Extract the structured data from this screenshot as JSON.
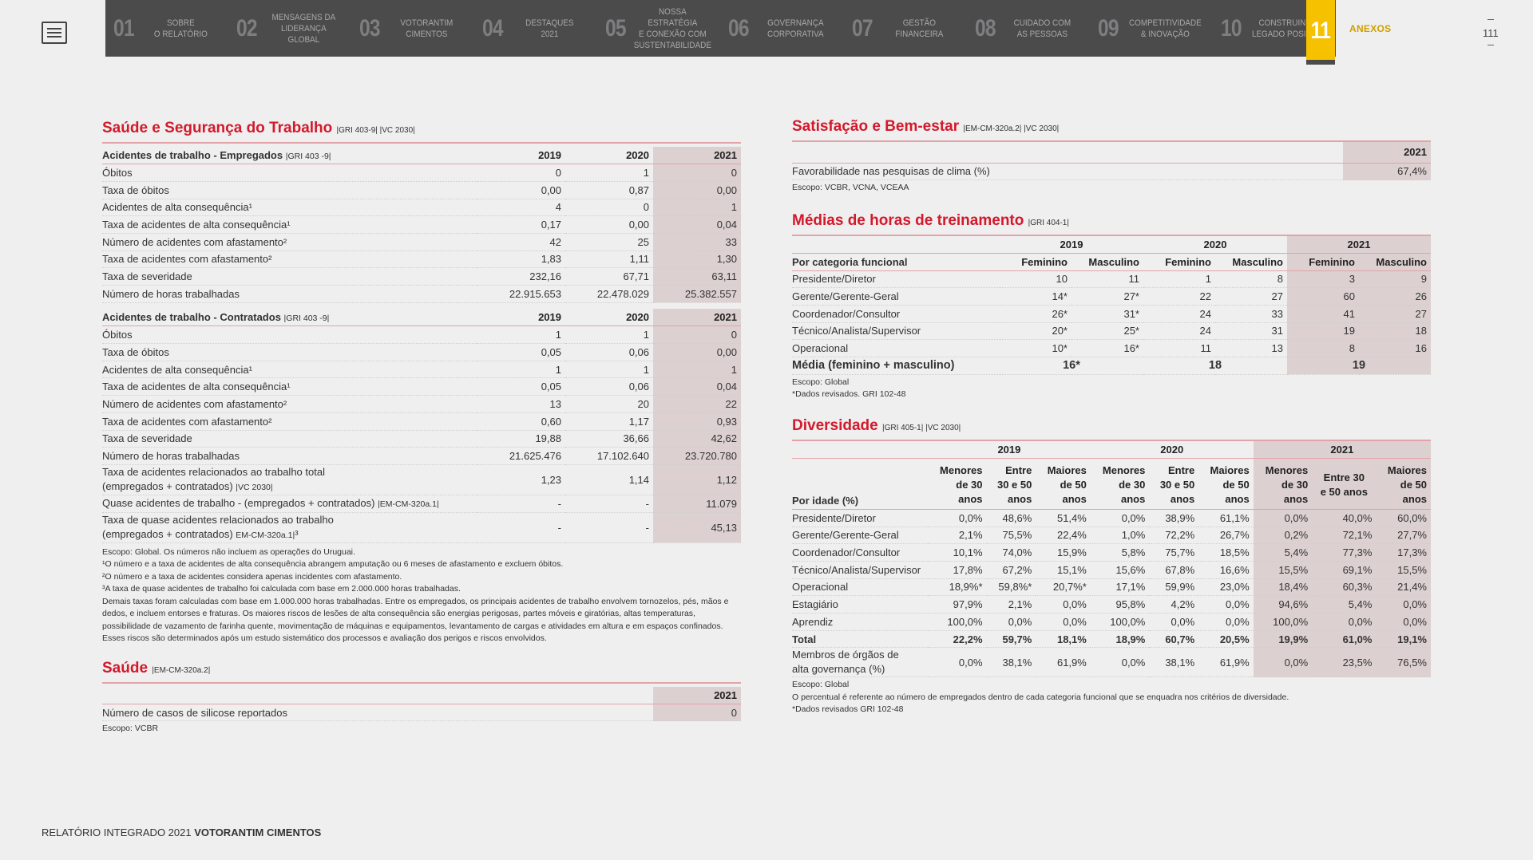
{
  "nav": {
    "items": [
      {
        "num": "01",
        "label": "SOBRE<br>O RELATÓRIO"
      },
      {
        "num": "02",
        "label": "MENSAGENS DA<br>LIDERANÇA GLOBAL"
      },
      {
        "num": "03",
        "label": "VOTORANTIM<br>CIMENTOS"
      },
      {
        "num": "04",
        "label": "DESTAQUES<br>2021"
      },
      {
        "num": "05",
        "label": "NOSSA ESTRATÉGIA<br>E CONEXÃO COM<br>SUSTENTABILIDADE"
      },
      {
        "num": "06",
        "label": "GOVERNANÇA<br>CORPORATIVA"
      },
      {
        "num": "07",
        "label": "GESTÃO<br>FINANCEIRA"
      },
      {
        "num": "08",
        "label": "CUIDADO COM<br>AS PESSOAS"
      },
      {
        "num": "09",
        "label": "COMPETITIVIDADE<br>& INOVAÇÃO"
      },
      {
        "num": "10",
        "label": "CONSTRUINDO<br>LEGADO POSITIVO"
      }
    ],
    "active_num": "11",
    "anexos": "ANEXOS",
    "page_number": "111"
  },
  "saude_seg": {
    "title": "Saúde e Segurança do Trabalho",
    "tag": "|GRI 403-9| |VC 2030|",
    "years": [
      "2019",
      "2020",
      "2021"
    ],
    "empregados": {
      "title": "Acidentes de trabalho - Empregados",
      "tag": "|GRI 403 -9|",
      "rows": [
        {
          "label": "Óbitos",
          "v": [
            "0",
            "1",
            "0"
          ]
        },
        {
          "label": "Taxa de óbitos",
          "v": [
            "0,00",
            "0,87",
            "0,00"
          ]
        },
        {
          "label": "Acidentes de alta consequência¹",
          "v": [
            "4",
            "0",
            "1"
          ]
        },
        {
          "label": "Taxa de acidentes de alta consequência¹",
          "v": [
            "0,17",
            "0,00",
            "0,04"
          ]
        },
        {
          "label": "Número de acidentes com afastamento²",
          "v": [
            "42",
            "25",
            "33"
          ]
        },
        {
          "label": "Taxa de acidentes com afastamento²",
          "v": [
            "1,83",
            "1,11",
            "1,30"
          ]
        },
        {
          "label": "Taxa de severidade",
          "v": [
            "232,16",
            "67,71",
            "63,11"
          ]
        },
        {
          "label": "Número de horas trabalhadas",
          "v": [
            "22.915.653",
            "22.478.029",
            "25.382.557"
          ]
        }
      ]
    },
    "contratados": {
      "title": "Acidentes de trabalho - Contratados",
      "tag": "|GRI 403 -9|",
      "rows": [
        {
          "label": "Óbitos",
          "v": [
            "1",
            "1",
            "0"
          ]
        },
        {
          "label": "Taxa de óbitos",
          "v": [
            "0,05",
            "0,06",
            "0,00"
          ]
        },
        {
          "label": "Acidentes de alta consequência¹",
          "v": [
            "1",
            "1",
            "1"
          ]
        },
        {
          "label": "Taxa de acidentes de alta consequência¹",
          "v": [
            "0,05",
            "0,06",
            "0,04"
          ]
        },
        {
          "label": "Número de acidentes com afastamento²",
          "v": [
            "13",
            "20",
            "22"
          ]
        },
        {
          "label": "Taxa de acidentes com afastamento²",
          "v": [
            "0,60",
            "1,17",
            "0,93"
          ]
        },
        {
          "label": "Taxa de severidade",
          "v": [
            "19,88",
            "36,66",
            "42,62"
          ]
        },
        {
          "label": "Número de horas trabalhadas",
          "v": [
            "21.625.476",
            "17.102.640",
            "23.720.780"
          ]
        }
      ],
      "extra": [
        {
          "label": "Taxa de acidentes relacionados ao trabalho total<br>(empregados + contratados) <b class='small'>|VC 2030|</b>",
          "v": [
            "1,23",
            "1,14",
            "1,12"
          ]
        },
        {
          "label": "Quase acidentes de trabalho - (empregados + contratados) <b class='small'>|EM-CM-320a.1|</b>",
          "v": [
            "-",
            "-",
            "11.079"
          ]
        },
        {
          "label": "Taxa de quase acidentes relacionados ao trabalho<br>(empregados + contratados) <b class='small'>EM-CM-320a.1|</b>³",
          "v": [
            "-",
            "-",
            "45,13"
          ]
        }
      ]
    },
    "notes": "Escopo: Global. Os números não incluem as operações do Uruguai.<br>¹O número e a taxa de acidentes de alta consequência abrangem amputação ou 6 meses de afastamento e excluem óbitos.<br>²O número e a taxa de acidentes considera apenas incidentes com afastamento.<br>³A taxa de quase acidentes de trabalho foi calculada com base em 2.000.000 horas trabalhadas.<br>Demais taxas foram calculadas com base em 1.000.000 horas trabalhadas. Entre os empregados, os principais acidentes de trabalho envolvem tornozelos, pés, mãos e dedos, e incluem entorses e fraturas. Os maiores riscos de lesões de alta consequência são energias perigosas, partes móveis e giratórias, altas temperaturas, possibilidade de vazamento de farinha quente, movimentação de máquinas e equipamentos, levantamento de cargas e atividades em altura e em espaços confinados. Esses riscos são determinados após um estudo sistemático dos processos e avaliação dos perigos e riscos envolvidos."
  },
  "saude": {
    "title": "Saúde",
    "tag": "|EM-CM-320a.2|",
    "year": "2021",
    "row_label": "Número de casos de silicose reportados",
    "row_value": "0",
    "note": "Escopo: VCBR"
  },
  "satisfacao": {
    "title": "Satisfação e Bem-estar",
    "tag": "|EM-CM-320a.2| |VC 2030|",
    "year": "2021",
    "row_label": "Favorabilidade nas pesquisas de clima (%)",
    "row_value": "67,4%",
    "note": "Escopo: VCBR, VCNA, VCEAA"
  },
  "treinamento": {
    "title": "Médias de horas de treinamento",
    "tag": "|GRI 404-1|",
    "years": [
      "2019",
      "2020",
      "2021"
    ],
    "cat_label": "Por categoria funcional",
    "sub": [
      "Feminino",
      "Masculino"
    ],
    "rows": [
      {
        "label": "Presidente/Diretor",
        "v": [
          "10",
          "11",
          "1",
          "8",
          "3",
          "9"
        ]
      },
      {
        "label": "Gerente/Gerente-Geral",
        "v": [
          "14*",
          "27*",
          "22",
          "27",
          "60",
          "26"
        ]
      },
      {
        "label": "Coordenador/Consultor",
        "v": [
          "26*",
          "31*",
          "24",
          "33",
          "41",
          "27"
        ]
      },
      {
        "label": "Técnico/Analista/Supervisor",
        "v": [
          "20*",
          "25*",
          "24",
          "31",
          "19",
          "18"
        ]
      },
      {
        "label": "Operacional",
        "v": [
          "10*",
          "16*",
          "11",
          "13",
          "8",
          "16"
        ]
      }
    ],
    "avg_label": "Média (feminino + masculino)",
    "avg": [
      "16*",
      "18",
      "19"
    ],
    "notes": "Escopo: Global<br>*Dados revisados. GRI 102-48"
  },
  "diversidade": {
    "title": "Diversidade",
    "tag": "|GRI 405-1| |VC 2030|",
    "years": [
      "2019",
      "2020",
      "2021"
    ],
    "cat_label": "Por idade (%)",
    "sub": [
      "Menores<br>de 30<br>anos",
      "Entre<br>30 e 50<br>anos",
      "Maiores<br>de 50<br>anos"
    ],
    "sub2021": [
      "Menores<br>de 30<br>anos",
      "Entre 30<br>e 50 anos",
      "Maiores<br>de 50<br>anos"
    ],
    "rows": [
      {
        "label": "Presidente/Diretor",
        "v": [
          "0,0%",
          "48,6%",
          "51,4%",
          "0,0%",
          "38,9%",
          "61,1%",
          "0,0%",
          "40,0%",
          "60,0%"
        ]
      },
      {
        "label": "Gerente/Gerente-Geral",
        "v": [
          "2,1%",
          "75,5%",
          "22,4%",
          "1,0%",
          "72,2%",
          "26,7%",
          "0,2%",
          "72,1%",
          "27,7%"
        ]
      },
      {
        "label": "Coordenador/Consultor",
        "v": [
          "10,1%",
          "74,0%",
          "15,9%",
          "5,8%",
          "75,7%",
          "18,5%",
          "5,4%",
          "77,3%",
          "17,3%"
        ]
      },
      {
        "label": "Técnico/Analista/Supervisor",
        "v": [
          "17,8%",
          "67,2%",
          "15,1%",
          "15,6%",
          "67,8%",
          "16,6%",
          "15,5%",
          "69,1%",
          "15,5%"
        ]
      },
      {
        "label": "Operacional",
        "v": [
          "18,9%*",
          "59,8%*",
          "20,7%*",
          "17,1%",
          "59,9%",
          "23,0%",
          "18,4%",
          "60,3%",
          "21,4%"
        ]
      },
      {
        "label": "Estagiário",
        "v": [
          "97,9%",
          "2,1%",
          "0,0%",
          "95,8%",
          "4,2%",
          "0,0%",
          "94,6%",
          "5,4%",
          "0,0%"
        ]
      },
      {
        "label": "Aprendiz",
        "v": [
          "100,0%",
          "0,0%",
          "0,0%",
          "100,0%",
          "0,0%",
          "0,0%",
          "100,0%",
          "0,0%",
          "0,0%"
        ]
      }
    ],
    "total": {
      "label": "Total",
      "v": [
        "22,2%",
        "59,7%",
        "18,1%",
        "18,9%",
        "60,7%",
        "20,5%",
        "19,9%",
        "61,0%",
        "19,1%"
      ]
    },
    "membros": {
      "label": "Membros de órgãos de<br>alta governança (%)",
      "v": [
        "0,0%",
        "38,1%",
        "61,9%",
        "0,0%",
        "38,1%",
        "61,9%",
        "0,0%",
        "23,5%",
        "76,5%"
      ]
    },
    "notes": "Escopo: Global<br>O percentual é referente ao número de empregados dentro de cada categoria funcional que se enquadra nos critérios de diversidade.<br>*Dados revisados GRI 102-48"
  },
  "footer": {
    "prefix": "RELATÓRIO INTEGRADO 2021 ",
    "brand": "VOTORANTIM CIMENTOS"
  }
}
